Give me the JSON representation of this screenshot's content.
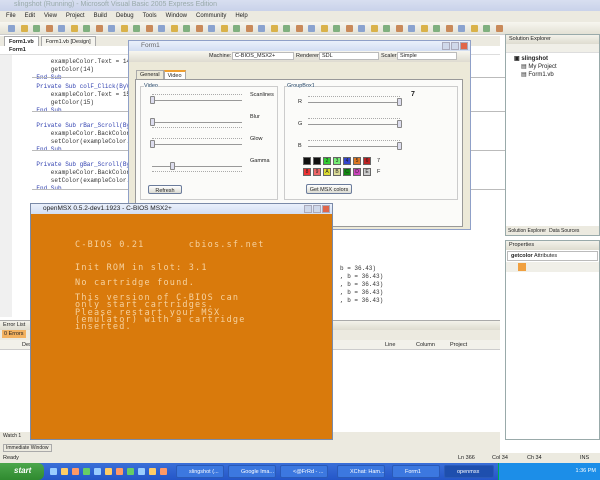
{
  "app": {
    "title": "slingshot (Running) - Microsoft Visual Basic 2005 Express Edition"
  },
  "menu": [
    "File",
    "Edit",
    "View",
    "Project",
    "Build",
    "Debug",
    "Tools",
    "Window",
    "Community",
    "Help"
  ],
  "doc_tabs": [
    "Form1.vb",
    "Form1.vb [Design]"
  ],
  "object_bar": "Form1",
  "code": [
    "        exampleColor.Text = 14",
    "        getColor(14)",
    "    End Sub",
    "    Private Sub colF_Click(ByV",
    "        exampleColor.Text = 15",
    "        getColor(15)",
    "    End Sub",
    "",
    "    Private Sub rBar_Scroll(By",
    "        exampleColor.BackColor",
    "        setColor(exampleColor.",
    "    End Sub",
    "",
    "    Private Sub gBar_Scroll(By",
    "        exampleColor.BackColor",
    "        setColor(exampleColor.",
    "    End Sub"
  ],
  "code_right": [
    "b = 36.43)",
    ", b = 36.43)",
    ", b = 36.43)",
    ", b = 36.43)",
    ", b = 36.43)"
  ],
  "form1": {
    "title": "Form1",
    "machine_label": "Machine:",
    "machine": "C-BIOS_MSX2+",
    "renderer_label": "Renderer:",
    "renderer": "SDL",
    "scaler_label": "Scaler:",
    "scaler": "Simple",
    "tabs": [
      "General",
      "Video"
    ],
    "video_group": "Video",
    "sliders": [
      {
        "label": "Scanlines",
        "value": 0
      },
      {
        "label": "Blur",
        "value": 0
      },
      {
        "label": "Glow",
        "value": 0
      },
      {
        "label": "Gamma",
        "value": 0.22
      }
    ],
    "refresh": "Refresh",
    "group2": "GroupBox1",
    "rgb": [
      {
        "label": "R",
        "value": 1
      },
      {
        "label": "G",
        "value": 1
      },
      {
        "label": "B",
        "value": 1
      }
    ],
    "value_label": "7",
    "swatches_row1": [
      {
        "t": "",
        "c": "#111111"
      },
      {
        "t": "",
        "c": "#111111"
      },
      {
        "t": "2",
        "c": "#33cc33"
      },
      {
        "t": "3",
        "c": "#77ee77"
      },
      {
        "t": "4",
        "c": "#3344cc"
      },
      {
        "t": "5",
        "c": "#dd7722"
      },
      {
        "t": "6",
        "c": "#bb2222"
      }
    ],
    "row1_label": "7",
    "swatches_row2": [
      {
        "t": "8",
        "c": "#ee3333"
      },
      {
        "t": "9",
        "c": "#ee6666"
      },
      {
        "t": "A",
        "c": "#dddd33"
      },
      {
        "t": "B",
        "c": "#dddd99"
      },
      {
        "t": "C",
        "c": "#118811"
      },
      {
        "t": "D",
        "c": "#cc44bb"
      },
      {
        "t": "E",
        "c": "#cccccc"
      }
    ],
    "row2_label": "F",
    "get_colors": "Get MSX colors"
  },
  "openmsx": {
    "title": "openMSX 0.5.2-dev1.1923 - C-BIOS MSX2+",
    "screen": [
      "C-BIOS 0.21       cbios.sf.net",
      "",
      "",
      "Init ROM in slot: 3.1",
      "",
      "No cartridge found.",
      "",
      "This version of C-BIOS can",
      "only start cartridges.",
      "Please restart your MSX",
      "(emulator) with a cartridge",
      "inserted."
    ],
    "bg": "#d97a0c"
  },
  "solution_explorer": {
    "title": "Solution Explorer",
    "project": "slingshot",
    "items": [
      "My Project",
      "Form1.vb"
    ],
    "tabs": [
      "Solution Explorer",
      "Data Sources"
    ]
  },
  "properties": {
    "title": "Properties",
    "object": "getcolor",
    "object_type": "Attributes"
  },
  "error_list": {
    "title": "Error List",
    "errors_tab": "0 Errors",
    "columns": [
      "Description",
      "Line",
      "Column",
      "Project"
    ]
  },
  "bottom_tabs": [
    "Watch 1",
    "Immediate Window"
  ],
  "status": {
    "ready": "Ready",
    "ln": "Ln 366",
    "col": "Col 34",
    "ch": "Ch 34",
    "mode": "INS"
  },
  "taskbar": {
    "start": "start",
    "tasks": [
      "slingshot (...",
      "Google Ima...",
      "<@FrRd - ...",
      "XChat: Ham...",
      "Form1",
      "openmsx"
    ],
    "clock": "1:36 PM"
  }
}
